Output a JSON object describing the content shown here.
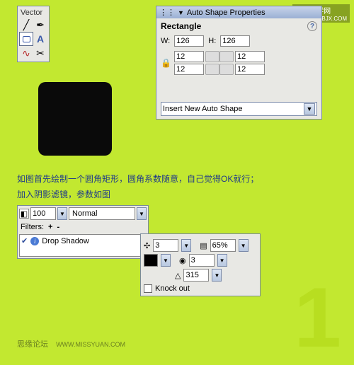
{
  "vector": {
    "title": "Vector"
  },
  "props": {
    "title": "Auto Shape Properties",
    "shape": "Rectangle",
    "w_label": "W:",
    "h_label": "H:",
    "width": "126",
    "height": "126",
    "corners": [
      "12",
      "12",
      "12",
      "12"
    ],
    "insert": "Insert New Auto Shape"
  },
  "instructions": {
    "line1": "如图首先绘制一个圆角矩形，圆角系数随意，自己觉得OK就行；",
    "line2": "加入阴影滤镜，参数如图"
  },
  "filters": {
    "opacity": "100",
    "blend": "Normal",
    "label": "Filters:",
    "plus": "+",
    "minus": "-",
    "item": "Drop Shadow"
  },
  "shadow": {
    "distance": "3",
    "opacity": "65%",
    "softness": "3",
    "angle": "315",
    "knockout": "Knock out"
  },
  "watermarks": {
    "tr": "网页教学网",
    "tr_url": "WWW.WEBJX.COM",
    "bl": "思缘论坛",
    "bl_url": "WWW.MISSYUAN.COM"
  },
  "big_number": "1"
}
